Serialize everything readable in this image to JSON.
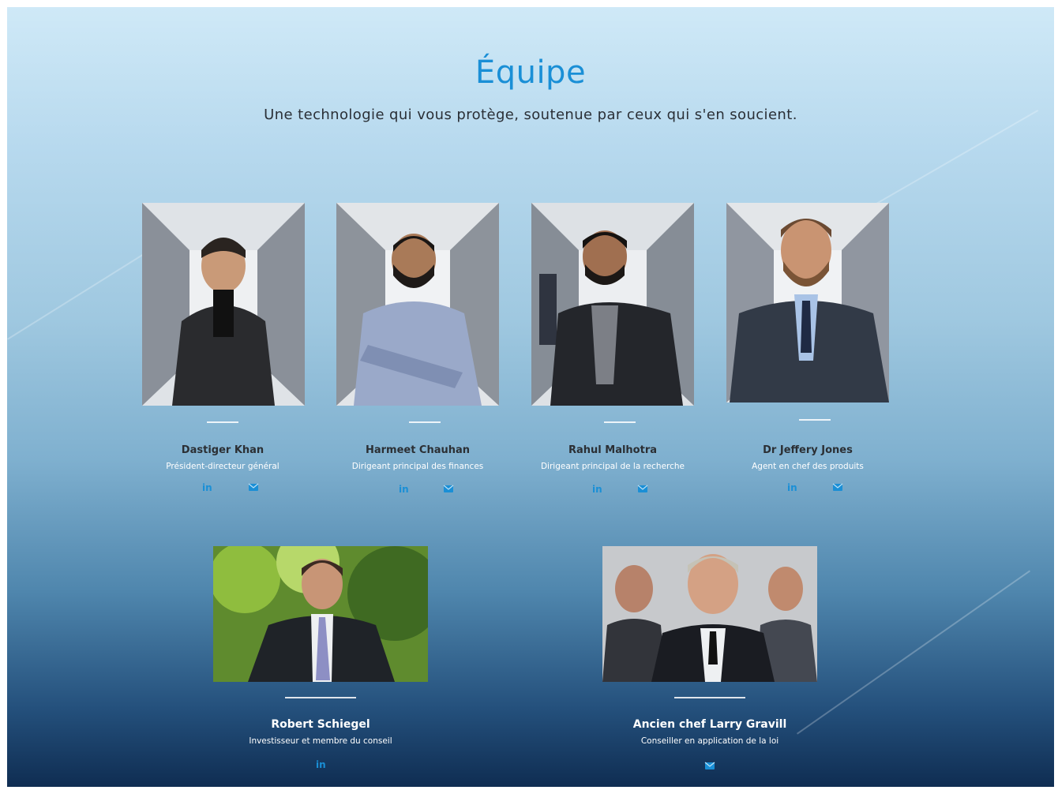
{
  "section": {
    "title": "Équipe",
    "subtitle": "Une technologie qui vous protège, soutenue par ceux qui s'en soucient."
  },
  "colors": {
    "accent": "#1a8fd6",
    "icon": "#1a8fd6"
  },
  "team": [
    {
      "name": "Dastiger Khan",
      "role": "Président-directeur général",
      "links": [
        "linkedin-icon",
        "email-icon"
      ]
    },
    {
      "name": "Harmeet Chauhan",
      "role": "Dirigeant principal des finances",
      "links": [
        "linkedin-icon",
        "email-icon"
      ]
    },
    {
      "name": "Rahul Malhotra",
      "role": "Dirigeant principal de la recherche",
      "links": [
        "linkedin-icon",
        "email-icon"
      ]
    },
    {
      "name": "Dr Jeffery Jones",
      "role": "Agent en chef des produits",
      "links": [
        "linkedin-icon",
        "email-icon"
      ]
    },
    {
      "name": "Robert Schiegel",
      "role": "Investisseur et membre du conseil",
      "links": [
        "linkedin-icon"
      ]
    },
    {
      "name": "Ancien chef Larry Gravill",
      "role": "Conseiller en application de la loi",
      "links": [
        "email-icon"
      ]
    }
  ]
}
